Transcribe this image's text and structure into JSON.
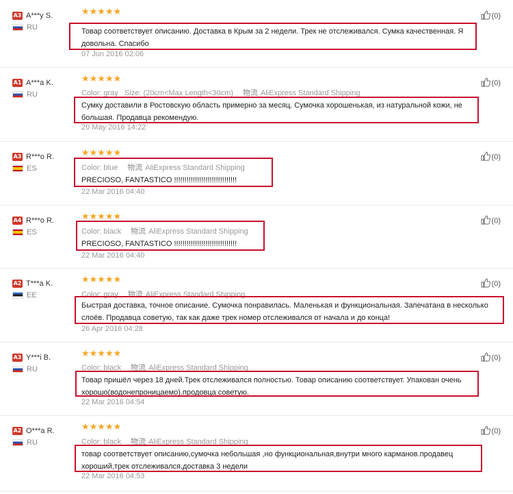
{
  "reviews": [
    {
      "level": "A3",
      "name": "A***y S.",
      "country": "RU",
      "flag": "ru",
      "stars": "★★★★★",
      "color_label": "",
      "color_value": "",
      "size_label": "",
      "size_value": "",
      "shipping": "",
      "text": "Товар соответствует описанию. Доставка в Крым за 2 недели. Трек не отслеживался. Сумка качественная. Я довольна. Спасибо",
      "date": "07 Jun 2016 02:06",
      "helpful_count": "(0)"
    },
    {
      "level": "A1",
      "name": "A***a K.",
      "country": "RU",
      "flag": "ru",
      "stars": "★★★★★",
      "color_label": "Color:",
      "color_value": "gray",
      "size_label": "Size:",
      "size_value": "(20cm<Max Length<30cm)",
      "shipping": "AliExpress Standard Shipping",
      "text": "Сумку доставили в Ростовскую область примерно за месяц. Сумочка хорошенькая, из натуральной кожи, не большая. Продавца рекомендую.",
      "date": "20 May 2016 14:22",
      "helpful_count": "(0)"
    },
    {
      "level": "A3",
      "name": "R***o R.",
      "country": "ES",
      "flag": "es",
      "stars": "★★★★★",
      "color_label": "Color:",
      "color_value": "blue",
      "size_label": "",
      "size_value": "",
      "shipping": "AliExpress Standard Shipping",
      "text": "PRECIOSO, FANTASTICO !!!!!!!!!!!!!!!!!!!!!!!!!!!!!!",
      "date": "22 Mar 2016 04:40",
      "helpful_count": "(0)"
    },
    {
      "level": "A4",
      "name": "R***o R.",
      "country": "ES",
      "flag": "es",
      "stars": "★★★★★",
      "color_label": "Color:",
      "color_value": "black",
      "size_label": "",
      "size_value": "",
      "shipping": "AliExpress Standard Shipping",
      "text": "PRECIOSO, FANTASTICO !!!!!!!!!!!!!!!!!!!!!!!!!!!!!!",
      "date": "22 Mar 2016 04:40",
      "helpful_count": "(0)"
    },
    {
      "level": "A2",
      "name": "T***a K.",
      "country": "EE",
      "flag": "ee",
      "stars": "★★★★★",
      "color_label": "Color:",
      "color_value": "gray",
      "size_label": "",
      "size_value": "",
      "shipping": "AliExpress Standard Shipping",
      "text": "Быстрая доставка, точное описание. Сумочка понравилась. Маленькая и функциональная. Запечатана в несколько слоёв. Продавца советую, так как даже трек номер отслеживался от начала и до конца!",
      "date": "26 Apr 2016 04:28",
      "helpful_count": "(0)"
    },
    {
      "level": "A3",
      "name": "Y***i B.",
      "country": "RU",
      "flag": "ru",
      "stars": "★★★★★",
      "color_label": "Color:",
      "color_value": "black",
      "size_label": "",
      "size_value": "",
      "shipping": "AliExpress Standard Shipping",
      "text": "Товар пришёл через 18 дней.Трек отслеживался полностью. Товар описанию соответствует. Упакован очень хорошо(водонепроницаемо).продовца советую.",
      "date": "22 Mar 2016 04:54",
      "helpful_count": "(0)"
    },
    {
      "level": "A2",
      "name": "O***a R.",
      "country": "RU",
      "flag": "ru",
      "stars": "★★★★★",
      "color_label": "Color:",
      "color_value": "black",
      "size_label": "",
      "size_value": "",
      "shipping": "AliExpress Standard Shipping",
      "text": "товар соответствует описанию,сумочка небольшая ,но функциональная,внутри много карманов.продавец хороший,трек отслеживался,доставка 3 недели",
      "date": "22 Mar 2016 04:53",
      "helpful_count": "(0)"
    }
  ],
  "shipping_icon_text": "物流",
  "colors": {
    "level_badge": "#d0392b",
    "stars": "#f5a623",
    "highlight": "#c8102e"
  }
}
